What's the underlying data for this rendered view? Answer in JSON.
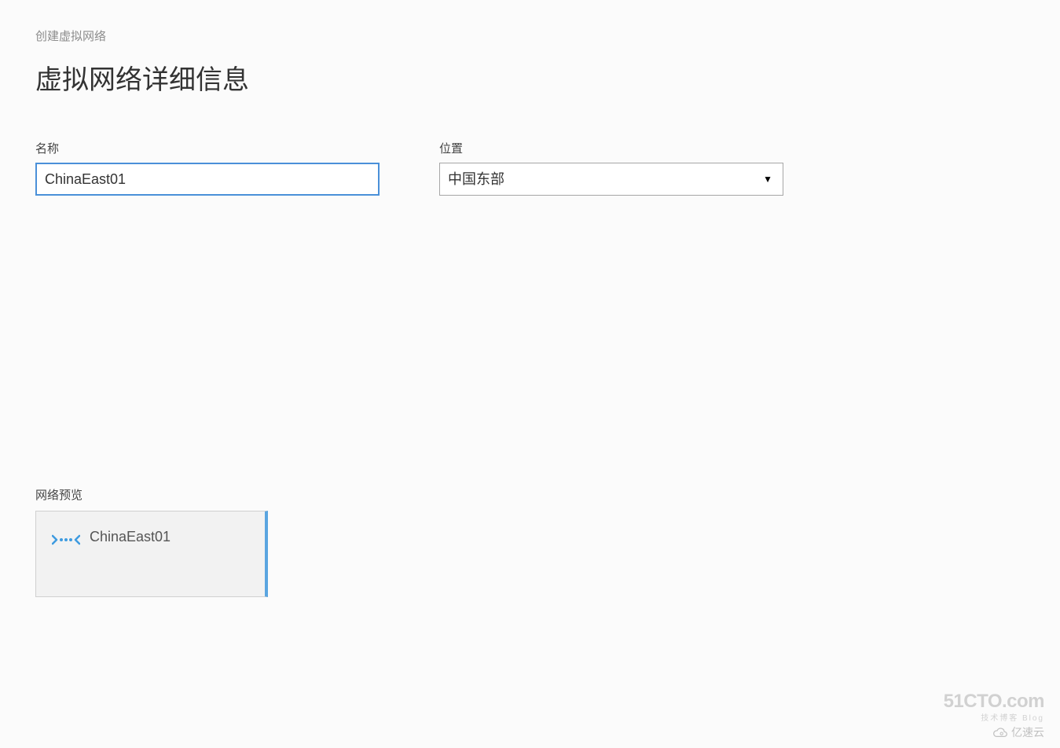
{
  "breadcrumb": "创建虚拟网络",
  "page_title": "虚拟网络详细信息",
  "form": {
    "name_label": "名称",
    "name_value": "ChinaEast01",
    "location_label": "位置",
    "location_value": "中国东部"
  },
  "preview": {
    "label": "网络预览",
    "name": "ChinaEast01"
  },
  "watermark": {
    "primary": "51CTO.com",
    "primary_sub": "技术博客 Blog",
    "secondary": "亿速云"
  }
}
